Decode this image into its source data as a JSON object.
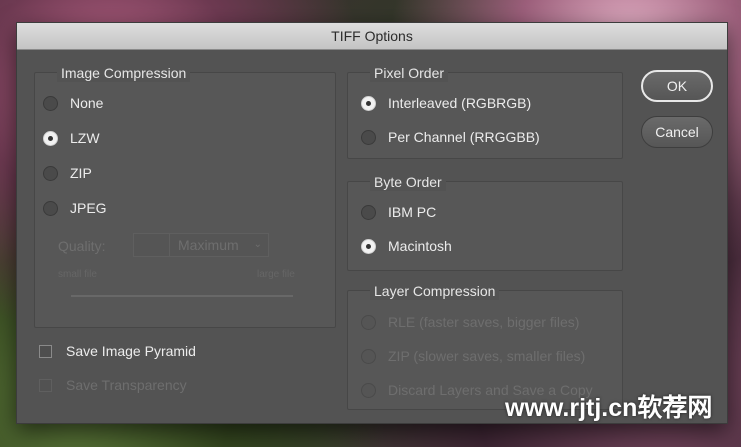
{
  "dialog": {
    "title": "TIFF Options"
  },
  "image_compression": {
    "legend": "Image Compression",
    "options": [
      {
        "label": "None",
        "selected": false
      },
      {
        "label": "LZW",
        "selected": true
      },
      {
        "label": "ZIP",
        "selected": false
      },
      {
        "label": "JPEG",
        "selected": false
      }
    ],
    "quality_label": "Quality:",
    "quality_value": "",
    "quality_select": "Maximum",
    "small_file": "small file",
    "large_file": "large file"
  },
  "save_image_pyramid": {
    "label": "Save Image Pyramid",
    "checked": false
  },
  "save_transparency": {
    "label": "Save Transparency",
    "checked": false
  },
  "pixel_order": {
    "legend": "Pixel Order",
    "options": [
      {
        "label": "Interleaved (RGBRGB)",
        "selected": true
      },
      {
        "label": "Per Channel (RRGGBB)",
        "selected": false
      }
    ]
  },
  "byte_order": {
    "legend": "Byte Order",
    "options": [
      {
        "label": "IBM PC",
        "selected": false
      },
      {
        "label": "Macintosh",
        "selected": true
      }
    ]
  },
  "layer_compression": {
    "legend": "Layer Compression",
    "options": [
      {
        "label": "RLE (faster saves, bigger files)"
      },
      {
        "label": "ZIP (slower saves, smaller files)"
      },
      {
        "label": "Discard Layers and Save a Copy"
      }
    ]
  },
  "buttons": {
    "ok": "OK",
    "cancel": "Cancel"
  },
  "watermark": "www.rjtj.cn软荐网"
}
